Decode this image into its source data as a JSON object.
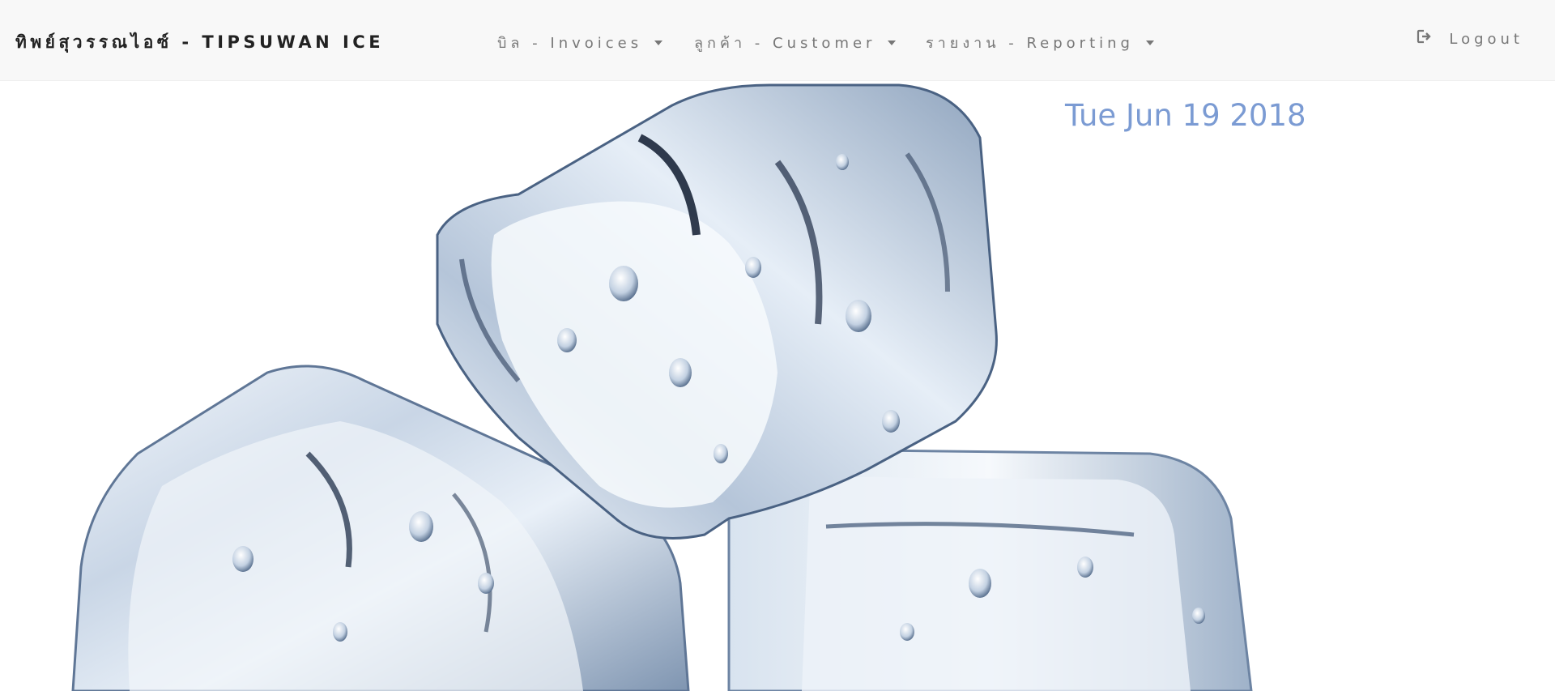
{
  "navbar": {
    "brand": "ทิพย์สุวรรณไอซ์ - TIPSUWAN ICE",
    "menus": [
      {
        "label": "บิล - Invoices"
      },
      {
        "label": "ลูกค้า - Customer"
      },
      {
        "label": "รายงาน - Reporting"
      }
    ],
    "logout": {
      "label": "Logout",
      "icon": "logout-icon"
    }
  },
  "hero": {
    "image": "ice-cubes-photo",
    "date": "Tue Jun 19 2018"
  },
  "colors": {
    "navbar_bg": "#f8f8f8",
    "nav_text": "#777777",
    "brand_text": "#222222",
    "date_text": "#7b9bd3"
  }
}
